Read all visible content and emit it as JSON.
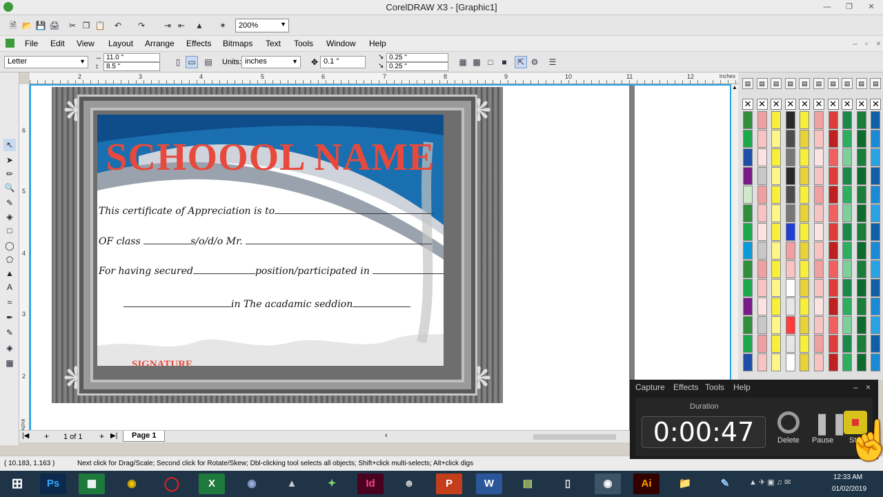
{
  "window": {
    "title": "CorelDRAW X3 - [Graphic1]"
  },
  "toolbar": {
    "zoom": "200%"
  },
  "menu": [
    "File",
    "Edit",
    "View",
    "Layout",
    "Arrange",
    "Effects",
    "Bitmaps",
    "Text",
    "Tools",
    "Window",
    "Help"
  ],
  "propbar": {
    "paper": "Letter",
    "width": "11.0 \"",
    "height": "8.5 \"",
    "units_label": "Units:",
    "units": "inches",
    "nudge": "0.1 \"",
    "dup_x": "0.25 \"",
    "dup_y": "0.25 \""
  },
  "ruler": {
    "unit": "inches",
    "h_ticks": [
      "2",
      "3",
      "4",
      "5",
      "6",
      "7",
      "8",
      "9",
      "10",
      "11",
      "12"
    ],
    "v_ticks": [
      "6",
      "5",
      "4",
      "3",
      "2"
    ],
    "v_unit": "inches"
  },
  "certificate": {
    "school": "SCHOOOL NAME",
    "line1": "This certificate of Appreciation is to",
    "line2a": "OF class",
    "line2b": "s/o/d/o Mr.",
    "line3a": "For having secured",
    "line3b": "position/participated in",
    "line4": "in The acadamic seddion",
    "signature": "SIGNATURE"
  },
  "pages": {
    "count": "1 of 1",
    "tab": "Page 1"
  },
  "status": {
    "coords": "( 10.183, 1.163 )",
    "hint": "Next click for Drag/Scale; Second click for Rotate/Skew; Dbl-clicking tool selects all objects; Shift+click multi-selects; Alt+click digs"
  },
  "recorder": {
    "menu": [
      "Capture",
      "Effects",
      "Tools",
      "Help"
    ],
    "duration_label": "Duration",
    "time": "0:00:47",
    "delete": "Delete",
    "pause": "Pause",
    "stop": "St"
  },
  "taskbar": {
    "clock": "12:33 AM",
    "date": "01/02/2019",
    "apps": [
      "Ps",
      "X",
      "Id",
      "Ai",
      "P",
      "W"
    ]
  },
  "colors": {
    "accent": "#2aa3e6",
    "title_red": "#e74a3c",
    "taskbar": "#1f3447"
  }
}
